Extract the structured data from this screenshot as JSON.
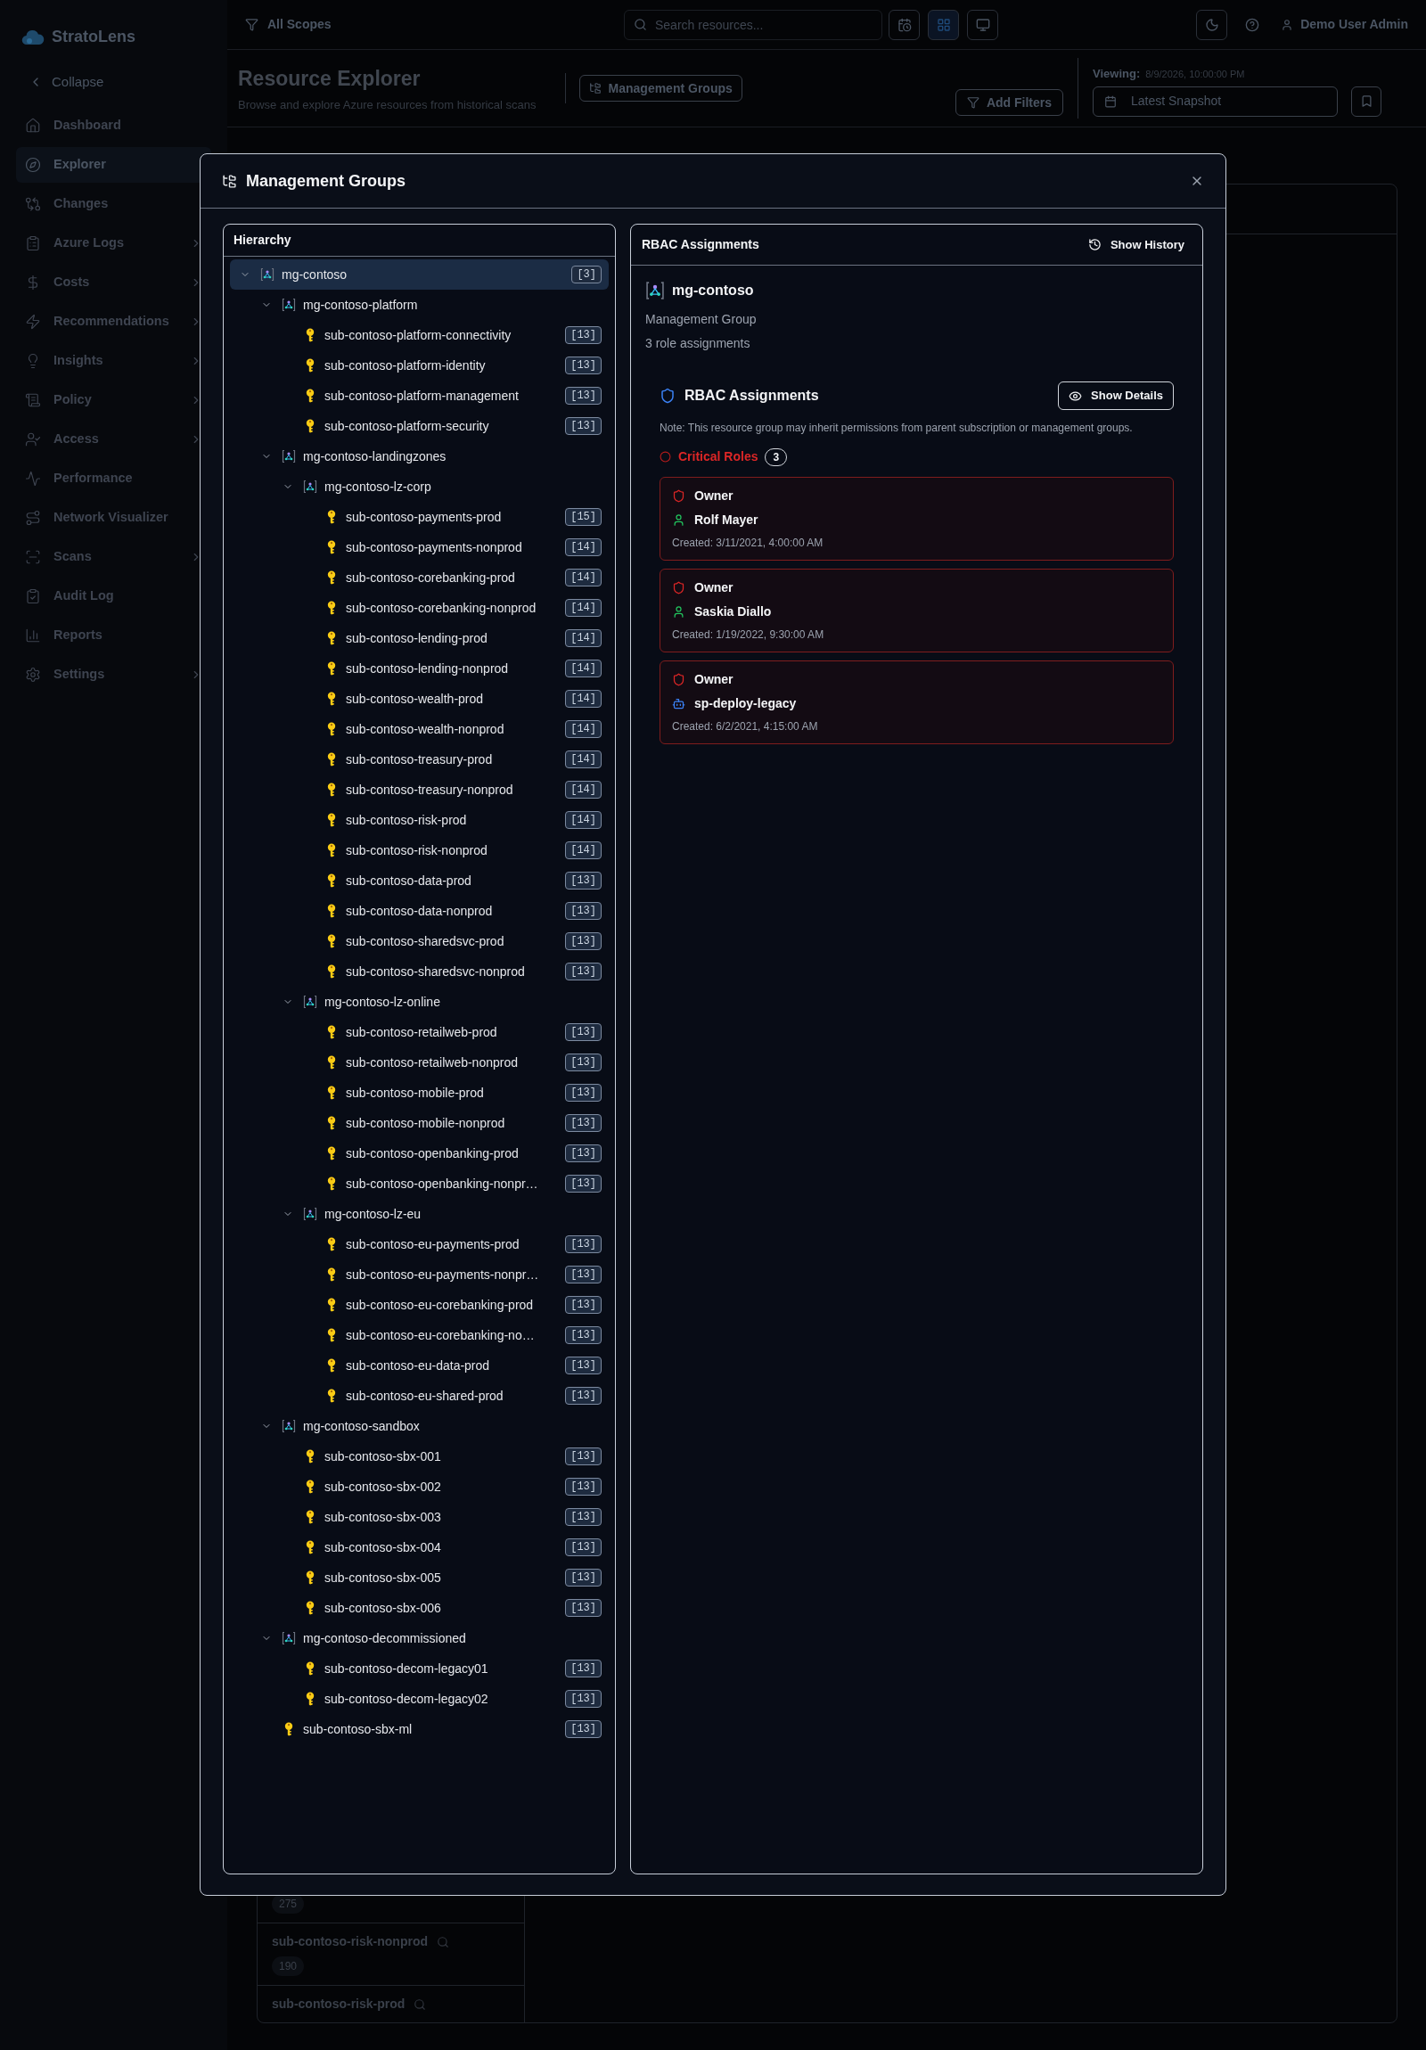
{
  "sidebar": {
    "brand": "StratoLens",
    "collapse": "Collapse",
    "items": [
      {
        "label": "Dashboard",
        "selected": false,
        "submenu": false
      },
      {
        "label": "Explorer",
        "selected": true,
        "submenu": false
      },
      {
        "label": "Changes",
        "selected": false,
        "submenu": false
      },
      {
        "label": "Azure Logs",
        "selected": false,
        "submenu": true
      },
      {
        "label": "Costs",
        "selected": false,
        "submenu": true
      },
      {
        "label": "Recommendations",
        "selected": false,
        "submenu": true
      },
      {
        "label": "Insights",
        "selected": false,
        "submenu": true
      },
      {
        "label": "Policy",
        "selected": false,
        "submenu": true
      },
      {
        "label": "Access",
        "selected": false,
        "submenu": true
      },
      {
        "label": "Performance",
        "selected": false,
        "submenu": false
      },
      {
        "label": "Network Visualizer",
        "selected": false,
        "submenu": false
      },
      {
        "label": "Scans",
        "selected": false,
        "submenu": true
      },
      {
        "label": "Audit Log",
        "selected": false,
        "submenu": false
      },
      {
        "label": "Reports",
        "selected": false,
        "submenu": false
      },
      {
        "label": "Settings",
        "selected": false,
        "submenu": true
      }
    ]
  },
  "topbar": {
    "scope": "All Scopes",
    "search": {
      "placeholder": "Search resources..."
    },
    "user": "Demo User Admin"
  },
  "header": {
    "title": "Resource Explorer",
    "subtitle": "Browse and explore Azure resources from historical scans",
    "mg_button": "Management Groups",
    "add_filters": "Add Filters",
    "viewing_label": "Viewing:",
    "viewing_time": "8/9/2026, 10:00:00 PM",
    "snapshot": "Latest Snapshot"
  },
  "background_list": [
    {
      "count": "275"
    },
    {
      "name": "sub-contoso-risk-nonprod",
      "count": "190"
    },
    {
      "name": "sub-contoso-risk-prod"
    }
  ],
  "modal": {
    "title": "Management Groups",
    "hierarchy": {
      "title": "Hierarchy",
      "tree": [
        {
          "kind": "group",
          "name": "mg-contoso",
          "count": "[3]",
          "selected": true,
          "expanded": true,
          "children": [
            {
              "kind": "group",
              "name": "mg-contoso-platform",
              "selected": false,
              "expanded": true,
              "children": [
                {
                  "kind": "subscription",
                  "name": "sub-contoso-platform-connectivity",
                  "count": "[13]",
                  "selected": false
                },
                {
                  "kind": "subscription",
                  "name": "sub-contoso-platform-identity",
                  "count": "[13]",
                  "selected": false
                },
                {
                  "kind": "subscription",
                  "name": "sub-contoso-platform-management",
                  "count": "[13]",
                  "selected": false
                },
                {
                  "kind": "subscription",
                  "name": "sub-contoso-platform-security",
                  "count": "[13]",
                  "selected": false
                }
              ]
            },
            {
              "kind": "group",
              "name": "mg-contoso-landingzones",
              "selected": false,
              "expanded": true,
              "children": [
                {
                  "kind": "group",
                  "name": "mg-contoso-lz-corp",
                  "selected": false,
                  "expanded": true,
                  "children": [
                    {
                      "kind": "subscription",
                      "name": "sub-contoso-payments-prod",
                      "count": "[15]",
                      "selected": false
                    },
                    {
                      "kind": "subscription",
                      "name": "sub-contoso-payments-nonprod",
                      "count": "[14]",
                      "selected": false
                    },
                    {
                      "kind": "subscription",
                      "name": "sub-contoso-corebanking-prod",
                      "count": "[14]",
                      "selected": false
                    },
                    {
                      "kind": "subscription",
                      "name": "sub-contoso-corebanking-nonprod",
                      "count": "[14]",
                      "selected": false
                    },
                    {
                      "kind": "subscription",
                      "name": "sub-contoso-lending-prod",
                      "count": "[14]",
                      "selected": false
                    },
                    {
                      "kind": "subscription",
                      "name": "sub-contoso-lending-nonprod",
                      "count": "[14]",
                      "selected": false
                    },
                    {
                      "kind": "subscription",
                      "name": "sub-contoso-wealth-prod",
                      "count": "[14]",
                      "selected": false
                    },
                    {
                      "kind": "subscription",
                      "name": "sub-contoso-wealth-nonprod",
                      "count": "[14]",
                      "selected": false
                    },
                    {
                      "kind": "subscription",
                      "name": "sub-contoso-treasury-prod",
                      "count": "[14]",
                      "selected": false
                    },
                    {
                      "kind": "subscription",
                      "name": "sub-contoso-treasury-nonprod",
                      "count": "[14]",
                      "selected": false
                    },
                    {
                      "kind": "subscription",
                      "name": "sub-contoso-risk-prod",
                      "count": "[14]",
                      "selected": false
                    },
                    {
                      "kind": "subscription",
                      "name": "sub-contoso-risk-nonprod",
                      "count": "[14]",
                      "selected": false
                    },
                    {
                      "kind": "subscription",
                      "name": "sub-contoso-data-prod",
                      "count": "[13]",
                      "selected": false
                    },
                    {
                      "kind": "subscription",
                      "name": "sub-contoso-data-nonprod",
                      "count": "[13]",
                      "selected": false
                    },
                    {
                      "kind": "subscription",
                      "name": "sub-contoso-sharedsvc-prod",
                      "count": "[13]",
                      "selected": false
                    },
                    {
                      "kind": "subscription",
                      "name": "sub-contoso-sharedsvc-nonprod",
                      "count": "[13]",
                      "selected": false
                    }
                  ]
                },
                {
                  "kind": "group",
                  "name": "mg-contoso-lz-online",
                  "selected": false,
                  "expanded": true,
                  "children": [
                    {
                      "kind": "subscription",
                      "name": "sub-contoso-retailweb-prod",
                      "count": "[13]",
                      "selected": false
                    },
                    {
                      "kind": "subscription",
                      "name": "sub-contoso-retailweb-nonprod",
                      "count": "[13]",
                      "selected": false
                    },
                    {
                      "kind": "subscription",
                      "name": "sub-contoso-mobile-prod",
                      "count": "[13]",
                      "selected": false
                    },
                    {
                      "kind": "subscription",
                      "name": "sub-contoso-mobile-nonprod",
                      "count": "[13]",
                      "selected": false
                    },
                    {
                      "kind": "subscription",
                      "name": "sub-contoso-openbanking-prod",
                      "count": "[13]",
                      "selected": false
                    },
                    {
                      "kind": "subscription",
                      "name": "sub-contoso-openbanking-nonpr…",
                      "count": "[13]",
                      "selected": false
                    }
                  ]
                },
                {
                  "kind": "group",
                  "name": "mg-contoso-lz-eu",
                  "selected": false,
                  "expanded": true,
                  "children": [
                    {
                      "kind": "subscription",
                      "name": "sub-contoso-eu-payments-prod",
                      "count": "[13]",
                      "selected": false
                    },
                    {
                      "kind": "subscription",
                      "name": "sub-contoso-eu-payments-nonpr…",
                      "count": "[13]",
                      "selected": false
                    },
                    {
                      "kind": "subscription",
                      "name": "sub-contoso-eu-corebanking-prod",
                      "count": "[13]",
                      "selected": false
                    },
                    {
                      "kind": "subscription",
                      "name": "sub-contoso-eu-corebanking-no…",
                      "count": "[13]",
                      "selected": false
                    },
                    {
                      "kind": "subscription",
                      "name": "sub-contoso-eu-data-prod",
                      "count": "[13]",
                      "selected": false
                    },
                    {
                      "kind": "subscription",
                      "name": "sub-contoso-eu-shared-prod",
                      "count": "[13]",
                      "selected": false
                    }
                  ]
                }
              ]
            },
            {
              "kind": "group",
              "name": "mg-contoso-sandbox",
              "selected": false,
              "expanded": true,
              "children": [
                {
                  "kind": "subscription",
                  "name": "sub-contoso-sbx-001",
                  "count": "[13]",
                  "selected": false
                },
                {
                  "kind": "subscription",
                  "name": "sub-contoso-sbx-002",
                  "count": "[13]",
                  "selected": false
                },
                {
                  "kind": "subscription",
                  "name": "sub-contoso-sbx-003",
                  "count": "[13]",
                  "selected": false
                },
                {
                  "kind": "subscription",
                  "name": "sub-contoso-sbx-004",
                  "count": "[13]",
                  "selected": false
                },
                {
                  "kind": "subscription",
                  "name": "sub-contoso-sbx-005",
                  "count": "[13]",
                  "selected": false
                },
                {
                  "kind": "subscription",
                  "name": "sub-contoso-sbx-006",
                  "count": "[13]",
                  "selected": false
                }
              ]
            },
            {
              "kind": "group",
              "name": "mg-contoso-decommissioned",
              "selected": false,
              "expanded": true,
              "children": [
                {
                  "kind": "subscription",
                  "name": "sub-contoso-decom-legacy01",
                  "count": "[13]",
                  "selected": false
                },
                {
                  "kind": "subscription",
                  "name": "sub-contoso-decom-legacy02",
                  "count": "[13]",
                  "selected": false
                }
              ]
            },
            {
              "kind": "subscription",
              "name": "sub-contoso-sbx-ml",
              "count": "[13]",
              "selected": false
            }
          ]
        }
      ]
    },
    "rbac": {
      "title": "RBAC Assignments",
      "history_button": "Show History",
      "resource": {
        "name": "mg-contoso",
        "type": "Management Group",
        "summary": "3 role assignments"
      },
      "section": {
        "title": "RBAC Assignments",
        "details_button": "Show Details",
        "note": "Note: This resource group may inherit permissions from parent subscription or management groups.",
        "critical_label": "Critical Roles",
        "critical_count": "3",
        "assignments": [
          {
            "role": "Owner",
            "kind": "user",
            "principal": "Rolf Mayer",
            "created": "Created: 3/11/2021, 4:00:00 AM"
          },
          {
            "role": "Owner",
            "kind": "user",
            "principal": "Saskia Diallo",
            "created": "Created: 1/19/2022, 9:30:00 AM"
          },
          {
            "role": "Owner",
            "kind": "service",
            "principal": "sp-deploy-legacy",
            "created": "Created: 6/2/2021, 4:15:00 AM"
          }
        ]
      }
    }
  }
}
